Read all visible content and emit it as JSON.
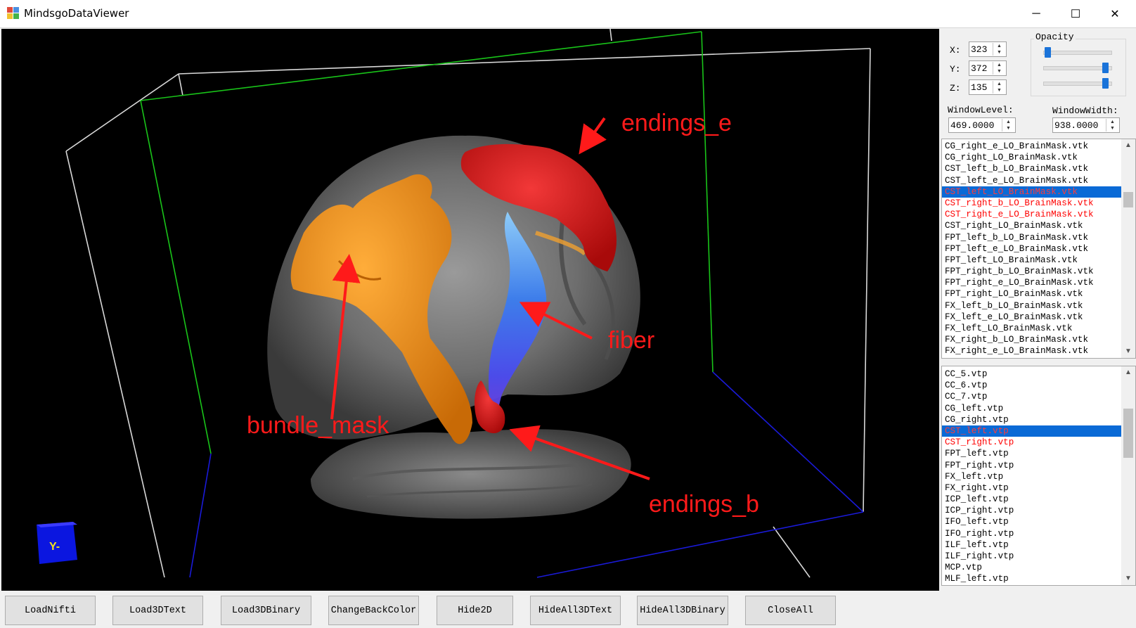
{
  "window": {
    "title": "MindsgoDataViewer",
    "minimize": "─",
    "maximize": "☐",
    "close": "✕"
  },
  "viewport": {
    "background": "#000000",
    "annotations": {
      "endings_e": "endings_e",
      "fiber": "fiber",
      "bundle_mask": "bundle_mask",
      "endings_b": "endings_b"
    },
    "annotation_color": "#ff1a1a",
    "orientation_cube_label": "Y-"
  },
  "coords": {
    "x_label": "X:",
    "x_value": "323",
    "y_label": "Y:",
    "y_value": "372",
    "z_label": "Z:",
    "z_value": "135"
  },
  "opacity": {
    "label": "Opacity",
    "slider_values": [
      0.02,
      0.96,
      0.96
    ]
  },
  "window_level": {
    "label": "WindowLevel:",
    "value": "469.0000"
  },
  "window_width": {
    "label": "WindowWidth:",
    "value": "938.0000"
  },
  "mask_list": {
    "items": [
      {
        "label": "CG_right_e_LO_BrainMask.vtk",
        "state": "normal"
      },
      {
        "label": "CG_right_LO_BrainMask.vtk",
        "state": "normal"
      },
      {
        "label": "CST_left_b_LO_BrainMask.vtk",
        "state": "normal"
      },
      {
        "label": "CST_left_e_LO_BrainMask.vtk",
        "state": "normal"
      },
      {
        "label": "CST_left_LO_BrainMask.vtk",
        "state": "selected"
      },
      {
        "label": "CST_right_b_LO_BrainMask.vtk",
        "state": "red"
      },
      {
        "label": "CST_right_e_LO_BrainMask.vtk",
        "state": "red"
      },
      {
        "label": "CST_right_LO_BrainMask.vtk",
        "state": "normal"
      },
      {
        "label": "FPT_left_b_LO_BrainMask.vtk",
        "state": "normal"
      },
      {
        "label": "FPT_left_e_LO_BrainMask.vtk",
        "state": "normal"
      },
      {
        "label": "FPT_left_LO_BrainMask.vtk",
        "state": "normal"
      },
      {
        "label": "FPT_right_b_LO_BrainMask.vtk",
        "state": "normal"
      },
      {
        "label": "FPT_right_e_LO_BrainMask.vtk",
        "state": "normal"
      },
      {
        "label": "FPT_right_LO_BrainMask.vtk",
        "state": "normal"
      },
      {
        "label": "FX_left_b_LO_BrainMask.vtk",
        "state": "normal"
      },
      {
        "label": "FX_left_e_LO_BrainMask.vtk",
        "state": "normal"
      },
      {
        "label": "FX_left_LO_BrainMask.vtk",
        "state": "normal"
      },
      {
        "label": "FX_right_b_LO_BrainMask.vtk",
        "state": "normal"
      },
      {
        "label": "FX_right_e_LO_BrainMask.vtk",
        "state": "normal"
      }
    ]
  },
  "fiber_list": {
    "items": [
      {
        "label": "CC_5.vtp",
        "state": "normal"
      },
      {
        "label": "CC_6.vtp",
        "state": "normal"
      },
      {
        "label": "CC_7.vtp",
        "state": "normal"
      },
      {
        "label": "CG_left.vtp",
        "state": "normal"
      },
      {
        "label": "CG_right.vtp",
        "state": "normal"
      },
      {
        "label": "CST_left.vtp",
        "state": "selected"
      },
      {
        "label": "CST_right.vtp",
        "state": "red"
      },
      {
        "label": "FPT_left.vtp",
        "state": "normal"
      },
      {
        "label": "FPT_right.vtp",
        "state": "normal"
      },
      {
        "label": "FX_left.vtp",
        "state": "normal"
      },
      {
        "label": "FX_right.vtp",
        "state": "normal"
      },
      {
        "label": "ICP_left.vtp",
        "state": "normal"
      },
      {
        "label": "ICP_right.vtp",
        "state": "normal"
      },
      {
        "label": "IFO_left.vtp",
        "state": "normal"
      },
      {
        "label": "IFO_right.vtp",
        "state": "normal"
      },
      {
        "label": "ILF_left.vtp",
        "state": "normal"
      },
      {
        "label": "ILF_right.vtp",
        "state": "normal"
      },
      {
        "label": "MCP.vtp",
        "state": "normal"
      },
      {
        "label": "MLF_left.vtp",
        "state": "normal"
      }
    ]
  },
  "buttons": {
    "load_nifti": "LoadNifti",
    "load_3d_text": "Load3DText",
    "load_3d_binary": "Load3DBinary",
    "change_back_color": "ChangeBackColor",
    "hide_2d": "Hide2D",
    "hide_all_3d_text": "HideAll3DText",
    "hide_all_3d_binary": "HideAll3DBinary",
    "close_all": "CloseAll"
  },
  "colors": {
    "selection": "#0a6ad6",
    "highlight_text": "#ff0000",
    "mask_orange": "#f08a10",
    "endings_red": "#d41414",
    "box_green": "#19c419",
    "box_blue": "#1a1ad8",
    "box_white": "#d8d8d8"
  }
}
